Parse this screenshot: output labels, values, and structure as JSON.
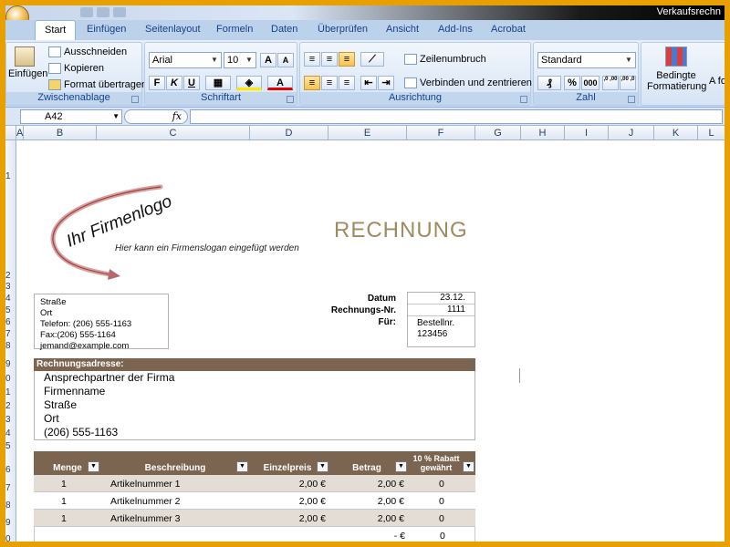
{
  "window": {
    "title": "Verkaufsrechn"
  },
  "tabs": [
    "Start",
    "Einfügen",
    "Seitenlayout",
    "Formeln",
    "Daten",
    "Überprüfen",
    "Ansicht",
    "Add-Ins",
    "Acrobat"
  ],
  "ribbon": {
    "clipboard": {
      "paste": "Einfügen",
      "cut": "Ausschneiden",
      "copy": "Kopieren",
      "format_painter": "Format übertragen",
      "label": "Zwischenablage"
    },
    "font": {
      "name": "Arial",
      "size": "10",
      "grow": "A",
      "shrink": "A",
      "bold": "F",
      "italic": "K",
      "underline": "U",
      "label": "Schriftart"
    },
    "alignment": {
      "wrap": "Zeilenumbruch",
      "merge": "Verbinden und zentrieren",
      "label": "Ausrichtung"
    },
    "number": {
      "format": "Standard",
      "percent": "%",
      "thousands": "000",
      "inc_dec": ",0 ,00",
      "dec_dec": ",00 ,0",
      "label": "Zahl"
    },
    "styles": {
      "conditional": "Bedingte Formatierung",
      "more": "A fo"
    }
  },
  "formula_bar": {
    "name_box": "A42",
    "fx": "fx",
    "value": ""
  },
  "columns": [
    "A",
    "B",
    "C",
    "D",
    "E",
    "F",
    "G",
    "H",
    "I",
    "J",
    "K",
    "L"
  ],
  "rows": [
    "1",
    "2",
    "3",
    "4",
    "5",
    "6",
    "7",
    "8",
    "9",
    "0",
    "1",
    "2",
    "3",
    "4",
    "5",
    "6",
    "7",
    "8",
    "9",
    "0"
  ],
  "invoice": {
    "logo_text": "Ihr Firmenlogo",
    "slogan": "Hier kann ein Firmenslogan eingefügt werden",
    "title": "RECHNUNG",
    "sender": {
      "street": "Straße",
      "city": "Ort",
      "phone": "Telefon: (206) 555-1163",
      "fax": "Fax:(206) 555-1164",
      "email": "jemand@example.com"
    },
    "meta": {
      "date_label": "Datum",
      "date_value": "23.12.",
      "number_label": "Rechnungs-Nr.",
      "number_value": "1111",
      "for_label": "Für:",
      "for_value1": "Bestellnr.",
      "for_value2": "123456"
    },
    "billing_header": "Rechnungsadresse:",
    "billing": [
      "Ansprechpartner der Firma",
      "Firmenname",
      "Straße",
      "Ort",
      "(206) 555-1163"
    ],
    "table_headers": {
      "qty": "Menge",
      "desc": "Beschreibung",
      "unit": "Einzelpreis",
      "amount": "Betrag",
      "discount_l1": "10 % Rabatt",
      "discount_l2": "gewährt"
    },
    "filter_glyph": "▼",
    "items": [
      {
        "qty": "1",
        "desc": "Artikelnummer 1",
        "unit": "2,00 €",
        "amount": "2,00 €",
        "discount": "0"
      },
      {
        "qty": "1",
        "desc": "Artikelnummer 2",
        "unit": "2,00 €",
        "amount": "2,00 €",
        "discount": "0"
      },
      {
        "qty": "1",
        "desc": "Artikelnummer 3",
        "unit": "2,00 €",
        "amount": "2,00 €",
        "discount": "0"
      },
      {
        "qty": "",
        "desc": "",
        "unit": "",
        "amount": "-   €",
        "discount": "0"
      }
    ]
  }
}
